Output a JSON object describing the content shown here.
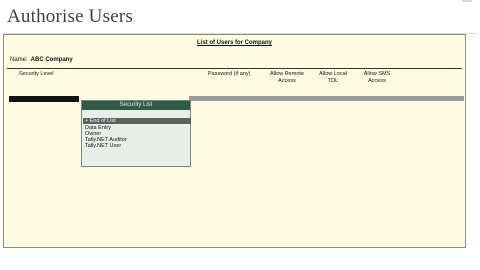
{
  "page_title": "Authorise Users",
  "list_title": "List of Users for Company",
  "name_label": "Name:",
  "company_name": "ABC Company",
  "columns": {
    "security_level": "Security Level",
    "password": "Password (if any)",
    "remote_access": [
      "Allow Remote",
      "Access"
    ],
    "local_tdl": [
      "Allow Local",
      "TDL"
    ],
    "sms_access": [
      "Allow SMS",
      "Access"
    ]
  },
  "popup": {
    "title": "Security List",
    "items": [
      "End of List",
      "Data Entry",
      "Owner",
      "Tally.NET Auditor",
      "Tally.NET User"
    ],
    "selected_marker": "+"
  },
  "colors": {
    "panel_bg": "#fffde1",
    "popup_header": "#2f5b46",
    "popup_bg": "#e6f0e8",
    "highlight": "#5f5f5f"
  }
}
